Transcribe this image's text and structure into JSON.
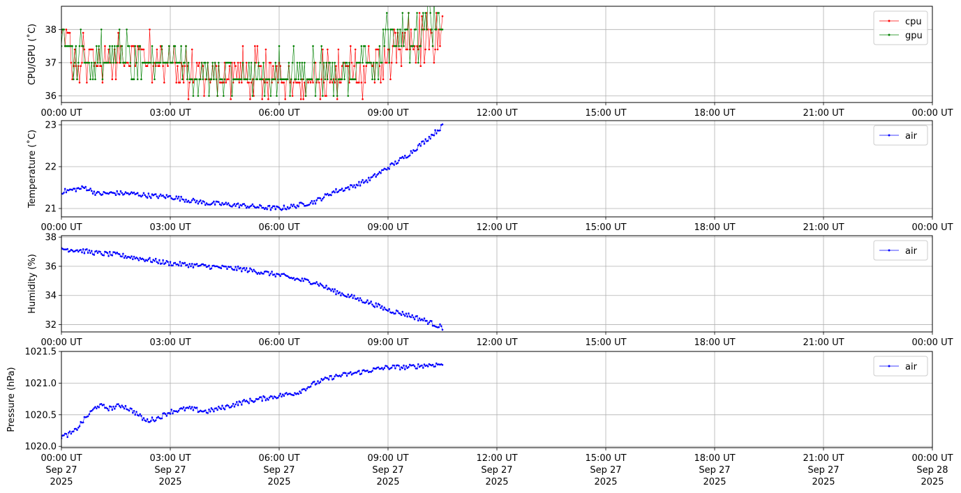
{
  "x_ticks": [
    "00:00 UT",
    "03:00 UT",
    "06:00 UT",
    "09:00 UT",
    "12:00 UT",
    "15:00 UT",
    "18:00 UT",
    "21:00 UT",
    "00:00 UT"
  ],
  "x_tick_dates": [
    "Sep 27",
    "Sep 27",
    "Sep 27",
    "Sep 27",
    "Sep 27",
    "Sep 27",
    "Sep 27",
    "Sep 27",
    "Sep 28"
  ],
  "x_tick_years": [
    "2025",
    "2025",
    "2025",
    "2025",
    "2025",
    "2025",
    "2025",
    "2025",
    "2025"
  ],
  "colors": {
    "cpu": "#ff0000",
    "gpu": "#008000",
    "air": "#0000ff",
    "grid": "#b0b0b0"
  },
  "chart_data": [
    {
      "type": "line",
      "ylabel": "CPU/GPU (˚C)",
      "xlim": [
        "2025-09-27 00:00",
        "2025-09-28 00:00"
      ],
      "ylim": [
        35.8,
        38.7
      ],
      "yticks": [
        36,
        37,
        38
      ],
      "ytick_labels": [
        "36",
        "37",
        "38"
      ],
      "grid": true,
      "legend": "top-right",
      "series": [
        {
          "name": "cpu",
          "color": "#ff0000",
          "x": [
            "00:00",
            "00:30",
            "01:00",
            "01:30",
            "02:00",
            "02:30",
            "03:00",
            "03:30",
            "04:00",
            "04:30",
            "05:00",
            "05:30",
            "06:00",
            "06:30",
            "07:00",
            "07:30",
            "08:00",
            "08:30",
            "09:00",
            "09:30",
            "10:00",
            "10:30"
          ],
          "y": [
            37.5,
            37.0,
            36.9,
            37.0,
            37.0,
            36.9,
            36.8,
            36.6,
            36.5,
            36.5,
            36.5,
            36.4,
            36.6,
            36.6,
            36.6,
            36.5,
            36.6,
            36.8,
            37.2,
            37.4,
            37.6,
            37.8
          ]
        },
        {
          "name": "gpu",
          "color": "#008000",
          "x": [
            "00:00",
            "00:30",
            "01:00",
            "01:30",
            "02:00",
            "02:30",
            "03:00",
            "03:30",
            "04:00",
            "04:30",
            "05:00",
            "05:30",
            "06:00",
            "06:30",
            "07:00",
            "07:30",
            "08:00",
            "08:30",
            "09:00",
            "09:30",
            "10:00",
            "10:30"
          ],
          "y": [
            37.5,
            37.1,
            37.0,
            37.1,
            37.0,
            37.0,
            36.9,
            36.7,
            36.6,
            36.5,
            36.5,
            36.5,
            36.6,
            36.7,
            36.7,
            36.6,
            36.7,
            36.9,
            37.3,
            37.5,
            37.8,
            38.0
          ]
        }
      ]
    },
    {
      "type": "line",
      "ylabel": "Temperature (˚C)",
      "xlim": [
        "2025-09-27 00:00",
        "2025-09-28 00:00"
      ],
      "ylim": [
        20.8,
        23.1
      ],
      "yticks": [
        21,
        22,
        23
      ],
      "ytick_labels": [
        "21",
        "22",
        "23"
      ],
      "grid": true,
      "legend": "top-right",
      "series": [
        {
          "name": "air",
          "color": "#0000ff",
          "x": [
            "00:00",
            "00:20",
            "00:40",
            "01:00",
            "01:30",
            "02:00",
            "02:30",
            "03:00",
            "03:30",
            "04:00",
            "04:30",
            "05:00",
            "05:30",
            "06:00",
            "06:30",
            "07:00",
            "07:30",
            "08:00",
            "08:30",
            "09:00",
            "09:30",
            "10:00",
            "10:30"
          ],
          "y": [
            21.4,
            21.45,
            21.5,
            21.35,
            21.37,
            21.35,
            21.3,
            21.28,
            21.2,
            21.13,
            21.1,
            21.07,
            21.03,
            21.0,
            21.07,
            21.17,
            21.4,
            21.52,
            21.7,
            21.98,
            22.25,
            22.6,
            22.97
          ]
        }
      ]
    },
    {
      "type": "line",
      "ylabel": "Humidity (%)",
      "xlim": [
        "2025-09-27 00:00",
        "2025-09-28 00:00"
      ],
      "ylim": [
        31.5,
        38.1
      ],
      "yticks": [
        32,
        34,
        36,
        38
      ],
      "ytick_labels": [
        "32",
        "34",
        "36",
        "38"
      ],
      "grid": true,
      "legend": "top-right",
      "series": [
        {
          "name": "air",
          "color": "#0000ff",
          "x": [
            "00:00",
            "00:30",
            "01:00",
            "01:30",
            "02:00",
            "02:30",
            "03:00",
            "03:30",
            "04:00",
            "04:30",
            "05:00",
            "05:30",
            "06:00",
            "06:30",
            "07:00",
            "07:30",
            "08:00",
            "08:30",
            "09:00",
            "09:30",
            "10:00",
            "10:30"
          ],
          "y": [
            37.2,
            37.1,
            36.9,
            36.8,
            36.6,
            36.4,
            36.2,
            36.1,
            36.0,
            35.9,
            35.8,
            35.6,
            35.4,
            35.1,
            34.9,
            34.3,
            33.9,
            33.5,
            33.0,
            32.7,
            32.3,
            31.8
          ]
        }
      ]
    },
    {
      "type": "line",
      "ylabel": "Pressure (hPa)",
      "xlim": [
        "2025-09-27 00:00",
        "2025-09-28 00:00"
      ],
      "ylim": [
        1019.98,
        1021.5
      ],
      "yticks": [
        1020.0,
        1020.5,
        1021.0,
        1021.5
      ],
      "ytick_labels": [
        "1020.0",
        "1020.5",
        "1021.0",
        "1021.5"
      ],
      "grid": true,
      "legend": "top-right",
      "series": [
        {
          "name": "air",
          "color": "#0000ff",
          "x": [
            "00:00",
            "00:20",
            "00:40",
            "01:00",
            "01:20",
            "01:40",
            "02:00",
            "02:20",
            "02:40",
            "03:00",
            "03:30",
            "04:00",
            "04:30",
            "05:00",
            "05:30",
            "06:00",
            "06:30",
            "07:00",
            "07:30",
            "08:00",
            "08:30",
            "09:00",
            "09:30",
            "10:00",
            "10:30"
          ],
          "y": [
            1020.15,
            1020.22,
            1020.45,
            1020.65,
            1020.6,
            1020.65,
            1020.55,
            1020.4,
            1020.45,
            1020.55,
            1020.6,
            1020.55,
            1020.62,
            1020.7,
            1020.75,
            1020.8,
            1020.85,
            1021.0,
            1021.1,
            1021.15,
            1021.2,
            1021.25,
            1021.25,
            1021.28,
            1021.3
          ]
        }
      ]
    }
  ]
}
